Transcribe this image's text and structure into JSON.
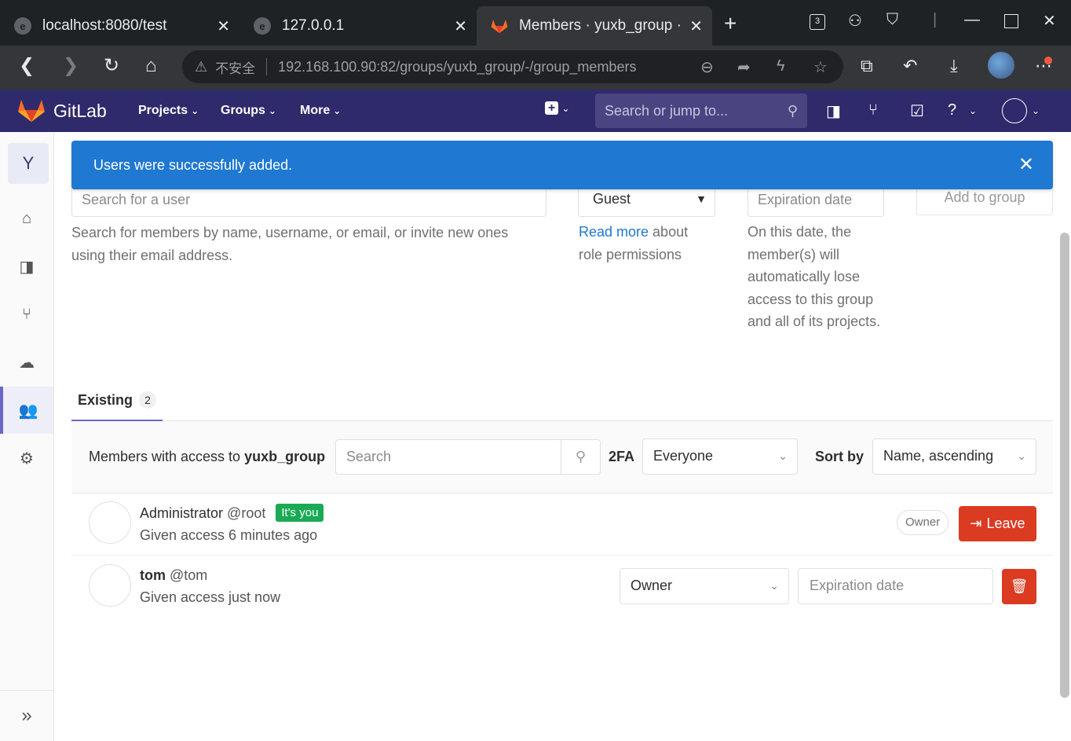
{
  "browser": {
    "tabs": [
      {
        "title": "localhost:8080/test",
        "close": "✕"
      },
      {
        "title": "127.0.0.1",
        "close": "✕"
      },
      {
        "title": "Members · yuxb_group ·",
        "close": "✕"
      }
    ],
    "new_tab": "+",
    "badge_count": "3",
    "security_label": "不安全",
    "url": "192.168.100.90:82/groups/yuxb_group/-/group_members"
  },
  "gitlab": {
    "brand": "GitLab",
    "nav": [
      "Projects",
      "Groups",
      "More"
    ],
    "search_placeholder": "Search or jump to...",
    "sidebar_avatar_letter": "Y"
  },
  "flash": {
    "message": "Users were successfully added."
  },
  "invite": {
    "user_search_placeholder": "Search for a user",
    "role_value": "Guest",
    "expiration_placeholder": "Expiration date",
    "add_button": "Add to group",
    "user_help": "Search for members by name, username, or email, or invite new ones using their email address.",
    "role_help_link": "Read more",
    "role_help_rest": " about role permissions",
    "expiration_help": "On this date, the member(s) will automatically lose access to this group and all of its projects."
  },
  "existing": {
    "tab_label": "Existing",
    "count": "2",
    "filter_label_prefix": "Members with access to ",
    "group_name": "yuxb_group",
    "search_placeholder": "Search",
    "twofa_label": "2FA",
    "twofa_value": "Everyone",
    "sort_label": "Sort by",
    "sort_value": "Name, ascending"
  },
  "members": [
    {
      "name": "Administrator",
      "username": "@root",
      "badge": "It's you",
      "access": "Given access 6 minutes ago",
      "role": "Owner",
      "action": "Leave"
    },
    {
      "name": "tom",
      "username": "@tom",
      "access": "Given access just now",
      "role": "Owner",
      "expiration_placeholder": "Expiration date"
    }
  ],
  "colors": {
    "header": "#2f2a6b",
    "flash": "#1f78d1",
    "danger": "#db3b21",
    "success": "#1aaa55",
    "link": "#1f78d1"
  }
}
